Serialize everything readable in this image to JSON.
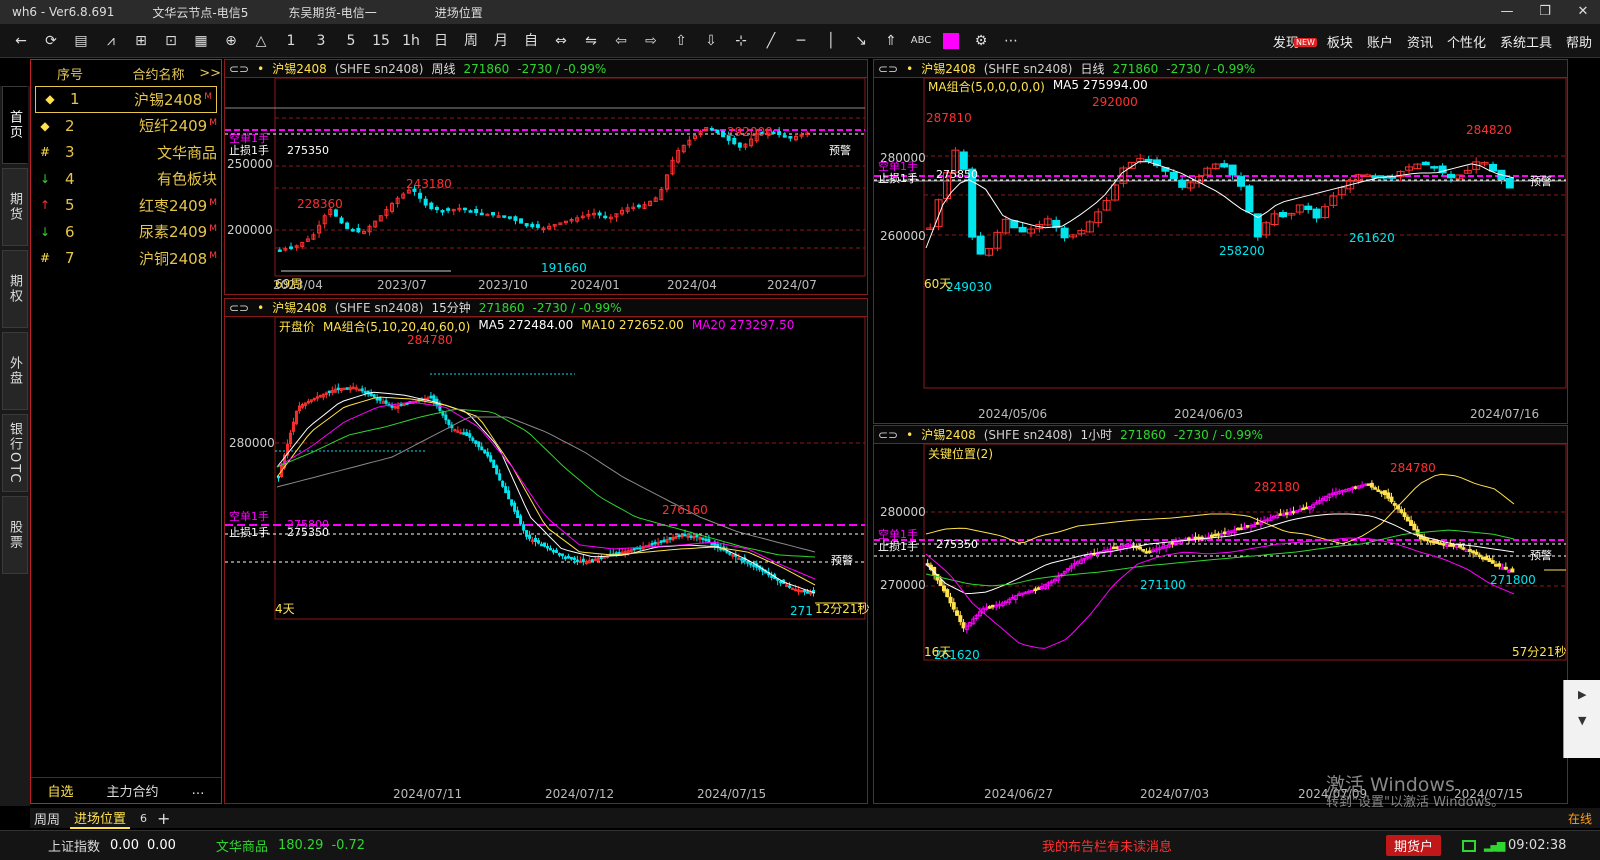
{
  "window": {
    "title": "wh6  -  Ver6.8.691",
    "server1": "文华云节点-电信5",
    "server2": "东吴期货-电信一",
    "page": "进场位置",
    "controls": [
      "—",
      "❐",
      "✕"
    ]
  },
  "toolbar": {
    "buttons": [
      "←",
      "⟳",
      "▤",
      "⩘",
      "⊞",
      "⊡",
      "▦",
      "⊕",
      "△",
      "1",
      "3",
      "5",
      "15",
      "1h",
      "日",
      "周",
      "月",
      "自",
      "⇔",
      "⇋",
      "⇦",
      "⇨",
      "⇧",
      "⇩",
      "⊹",
      "╱",
      "─",
      "│",
      "↘",
      "⇑",
      "ABC",
      "⚙",
      "⋯"
    ]
  },
  "menu": {
    "items": [
      "发现",
      "板块",
      "账户",
      "资讯",
      "个性化",
      "系统工具",
      "帮助"
    ],
    "new_badge": "NEW"
  },
  "sidetabs": [
    "首页",
    "期货",
    "期权",
    "外盘",
    "银行OTC",
    "股票"
  ],
  "watchlist": {
    "header": {
      "no": "序号",
      "name": "合约名称",
      "more": ">>"
    },
    "rows": [
      {
        "mark": "◆",
        "no": "1",
        "name": "沪锡2408",
        "flag": "M",
        "markColor": "#ffe24d"
      },
      {
        "mark": "◆",
        "no": "2",
        "name": "短纤2409",
        "flag": "M",
        "markColor": "#ffe24d"
      },
      {
        "mark": "#",
        "no": "3",
        "name": "文华商品",
        "flag": "",
        "markColor": "#ffe24d"
      },
      {
        "mark": "↓",
        "no": "4",
        "name": "有色板块",
        "flag": "",
        "markColor": "#2fd62f"
      },
      {
        "mark": "↑",
        "no": "5",
        "name": "红枣2409",
        "flag": "M",
        "markColor": "#ff3030"
      },
      {
        "mark": "↓",
        "no": "6",
        "name": "尿素2409",
        "flag": "M",
        "markColor": "#2fd62f"
      },
      {
        "mark": "#",
        "no": "7",
        "name": "沪铜2408",
        "flag": "M",
        "markColor": "#ffe24d"
      }
    ],
    "footer": {
      "tab1": "自选",
      "tab2": "主力合约",
      "more": "…"
    }
  },
  "panels": {
    "p1": {
      "name": "沪锡2408",
      "flag": "M",
      "code": "(SHFE sn2408)",
      "period": "周线",
      "price": "271860",
      "change": "-2730 / -0.99%",
      "ytick1": "250000",
      "ytick2": "200000",
      "high": "292000",
      "l1": "228360",
      "l2": "243180",
      "low": "191660",
      "shortOrder": "空单1手",
      "stopLoss": "止损1手",
      "stopVal": "275350",
      "warn": "预警",
      "count": "69周",
      "dates": [
        "2023/04",
        "2023/07",
        "2023/10",
        "2024/01",
        "2024/04",
        "2024/07"
      ]
    },
    "p2": {
      "name": "沪锡2408",
      "flag": "M",
      "code": "(SHFE sn2408)",
      "period": "15分钟",
      "price": "271860",
      "change": "-2730 / -0.99%",
      "ind": "开盘价",
      "ma": "MA组合(5,10,20,40,60,0)",
      "ma5": "MA5 272484.00",
      "ma10": "MA10 272652.00",
      "ma20": "MA20 273297.50",
      "ytick1": "280000",
      "high": "284780",
      "mid": "276160",
      "shortOrder": "空单1手",
      "shortVal": "275800",
      "stopLoss": "止损1手",
      "stopVal": "275350",
      "warn": "预警",
      "count": "4天",
      "timer": "12分21秒",
      "lastPrice": "271",
      "dates": [
        "2024/07/11",
        "2024/07/12",
        "2024/07/15"
      ]
    },
    "p3": {
      "name": "沪锡2408",
      "flag": "M",
      "code": "(SHFE sn2408)",
      "period": "日线",
      "price": "271860",
      "change": "-2730 / -0.99%",
      "ma": "MA组合(5,0,0,0,0,0)",
      "ma5": "MA5 275994.00",
      "ytick1": "280000",
      "ytick2": "260000",
      "l1": "287810",
      "high": "292000",
      "r1": "284820",
      "low1": "258200",
      "low2": "261620",
      "low0": "249030",
      "shortOrder": "空单1手",
      "stopLoss": "止损1手",
      "stopVal": "275850",
      "warn": "预警",
      "count": "60天",
      "dates": [
        "2024/05/06",
        "2024/06/03",
        "2024/07/16"
      ]
    },
    "p4": {
      "name": "沪锡2408",
      "flag": "M",
      "code": "(SHFE sn2408)",
      "period": "1小时",
      "price": "271860",
      "change": "-2730 / -0.99%",
      "ind": "关键位置(2)",
      "ytick1": "280000",
      "ytick2": "270000",
      "h1": "282180",
      "h2": "284780",
      "l1": "271100",
      "l2": "271800",
      "low": "261620",
      "shortOrder": "空单1手",
      "stopLoss": "止损1手",
      "stopVal": "275350",
      "warn": "预警",
      "count": "16天",
      "timer": "57分21秒",
      "dates": [
        "2024/06/27",
        "2024/07/03",
        "2024/07/09",
        "2024/07/15"
      ]
    }
  },
  "bottomtabs": {
    "t1": "周周",
    "t2": "进场位置",
    "t2count": "6",
    "add": "+"
  },
  "status": {
    "idx1": "上证指数",
    "idx1v": "0.00",
    "idx1c": "0.00",
    "idx2": "文华商品",
    "idx2v": "180.29",
    "idx2c": "-0.72",
    "notice": "我的布告栏有未读消息",
    "broker": "期货户",
    "time": "09:02:38",
    "online": "在线"
  },
  "activation": {
    "line1": "激活 Windows",
    "line2": "转到\"设置\"以激活 Windows。"
  },
  "colors": {
    "up": "#ff3030",
    "down": "#00e5ee",
    "ma5": "#ffffff",
    "ma10": "#ffe24d",
    "ma20": "#ff00ff",
    "ma40": "#2fd62f",
    "ma60": "#8a8a8a",
    "border": "#8a1a1a"
  }
}
